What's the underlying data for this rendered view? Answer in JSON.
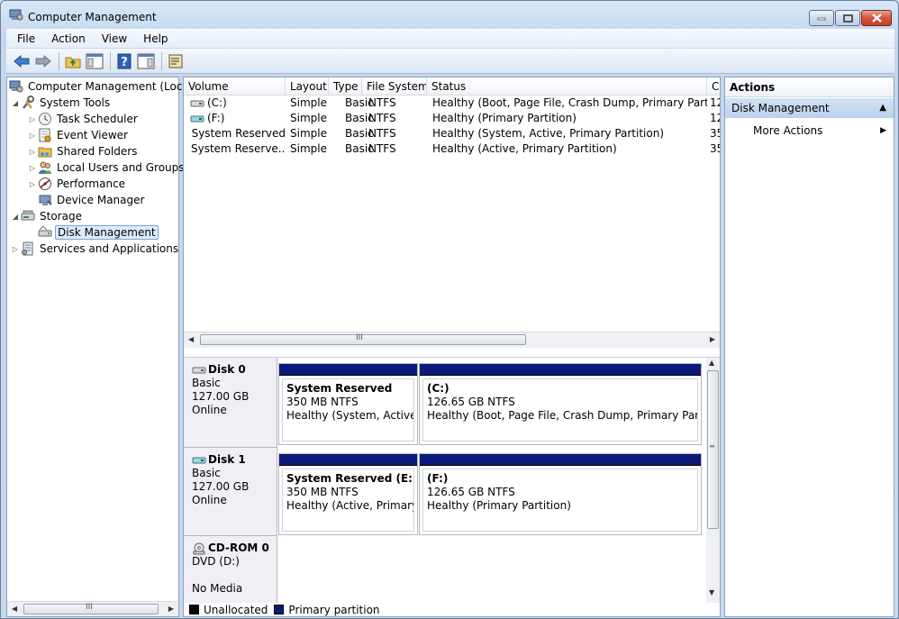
{
  "window": {
    "title": "Computer Management"
  },
  "menu": [
    "File",
    "Action",
    "View",
    "Help"
  ],
  "icons": {
    "back": "arrow-left-icon",
    "forward": "arrow-right-icon",
    "up": "folder-up-icon",
    "show_hide": "console-tree-icon",
    "help": "help-icon",
    "action_pane": "action-pane-icon",
    "properties": "properties-icon"
  },
  "tree": {
    "items": [
      {
        "label": "Computer Management (Local)",
        "icon": "computer-management-icon",
        "expander": ""
      },
      {
        "label": "System Tools",
        "icon": "tools-icon",
        "expander": "◢"
      },
      {
        "label": "Task Scheduler",
        "icon": "clock-icon",
        "expander": "▷"
      },
      {
        "label": "Event Viewer",
        "icon": "event-viewer-icon",
        "expander": "▷"
      },
      {
        "label": "Shared Folders",
        "icon": "shared-folder-icon",
        "expander": "▷"
      },
      {
        "label": "Local Users and Groups",
        "icon": "users-icon",
        "expander": "▷"
      },
      {
        "label": "Performance",
        "icon": "performance-icon",
        "expander": "▷"
      },
      {
        "label": "Device Manager",
        "icon": "device-manager-icon",
        "expander": ""
      },
      {
        "label": "Storage",
        "icon": "storage-icon",
        "expander": "◢"
      },
      {
        "label": "Disk Management",
        "icon": "disk-management-icon",
        "expander": ""
      },
      {
        "label": "Services and Applications",
        "icon": "services-icon",
        "expander": "▷"
      }
    ],
    "scroll_grip": "III"
  },
  "volumes": {
    "columns": [
      "Volume",
      "Layout",
      "Type",
      "File System",
      "Status",
      "C"
    ],
    "rows": [
      {
        "volume": "(C:)",
        "layout": "Simple",
        "type": "Basic",
        "fs": "NTFS",
        "status": "Healthy (Boot, Page File, Crash Dump, Primary Partition)",
        "cap": "12"
      },
      {
        "volume": "(F:)",
        "layout": "Simple",
        "type": "Basic",
        "fs": "NTFS",
        "status": "Healthy (Primary Partition)",
        "cap": "12"
      },
      {
        "volume": "System Reserved",
        "layout": "Simple",
        "type": "Basic",
        "fs": "NTFS",
        "status": "Healthy (System, Active, Primary Partition)",
        "cap": "35"
      },
      {
        "volume": "System Reserve...",
        "layout": "Simple",
        "type": "Basic",
        "fs": "NTFS",
        "status": "Healthy (Active, Primary Partition)",
        "cap": "35"
      }
    ],
    "scroll_grip": "III"
  },
  "disks": [
    {
      "name": "Disk 0",
      "type": "Basic",
      "size": "127.00 GB",
      "state": "Online",
      "partitions": [
        {
          "title": "System Reserved",
          "size": "350 MB NTFS",
          "status": "Healthy (System, Active, Pr"
        },
        {
          "title": "(C:)",
          "size": "126.65 GB NTFS",
          "status": "Healthy (Boot, Page File, Crash Dump, Primary Partition)"
        }
      ]
    },
    {
      "name": "Disk 1",
      "type": "Basic",
      "size": "127.00 GB",
      "state": "Online",
      "partitions": [
        {
          "title": "System Reserved  (E:)",
          "size": "350 MB NTFS",
          "status": "Healthy (Active, Primary Pa"
        },
        {
          "title": "(F:)",
          "size": "126.65 GB NTFS",
          "status": "Healthy (Primary Partition)"
        }
      ]
    },
    {
      "name": "CD-ROM 0",
      "type": "DVD (D:)",
      "size": "",
      "state": "No Media",
      "partitions": []
    }
  ],
  "legend": {
    "unallocated": "Unallocated",
    "primary": "Primary partition",
    "unallocated_color": "#000000",
    "primary_color": "#0b1a7a"
  },
  "actions": {
    "title": "Actions",
    "section": "Disk Management",
    "items": [
      "More Actions"
    ]
  }
}
